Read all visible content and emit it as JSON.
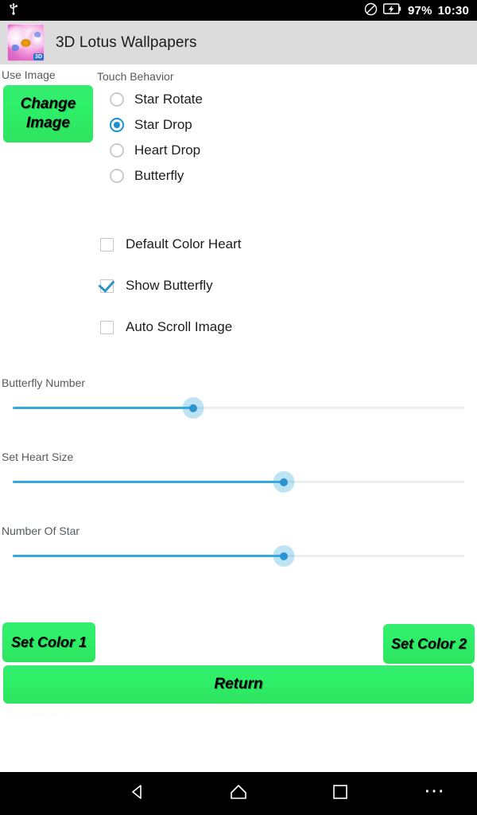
{
  "status_bar": {
    "usb_icon": "usb-icon",
    "dnd_icon": "do-not-disturb-icon",
    "battery_icon": "battery-charging-icon",
    "battery_percent": "97%",
    "time": "10:30"
  },
  "app_bar": {
    "icon": "lotus-app-icon",
    "icon_badge": "3D",
    "title": "3D Lotus Wallpapers",
    "background_color": "#dcdcdc"
  },
  "sections": {
    "use_image_label": "Use Image",
    "touch_behavior_label": "Touch Behavior"
  },
  "buttons": {
    "change_image": "Change Image",
    "change_image_line1": "Change",
    "change_image_line2": "Image",
    "set_color_1": "Set Color 1",
    "set_color_2": "Set Color 2",
    "return": "Return",
    "accent_green": "#2ee365"
  },
  "touch_behavior": {
    "selected": "Star Drop",
    "options": [
      {
        "label": "Star Rotate",
        "checked": false
      },
      {
        "label": "Star Drop",
        "checked": true
      },
      {
        "label": "Heart Drop",
        "checked": false
      },
      {
        "label": "Butterfly",
        "checked": false
      }
    ]
  },
  "checkboxes": [
    {
      "label": "Default Color Heart",
      "checked": false
    },
    {
      "label": "Show Butterfly",
      "checked": true
    },
    {
      "label": "Auto Scroll Image",
      "checked": false
    }
  ],
  "sliders": [
    {
      "label": "Butterfly Number",
      "percent": 40
    },
    {
      "label": "Set Heart Size",
      "percent": 60
    },
    {
      "label": "Number Of Star",
      "percent": 60
    }
  ],
  "slider_colors": {
    "active": "#35a8dd",
    "inactive": "#eceff0",
    "thumb": "#2b93cf"
  },
  "nav_bar": {
    "back": "back-icon",
    "home": "home-icon",
    "recents": "recents-icon",
    "more": "⋯"
  }
}
